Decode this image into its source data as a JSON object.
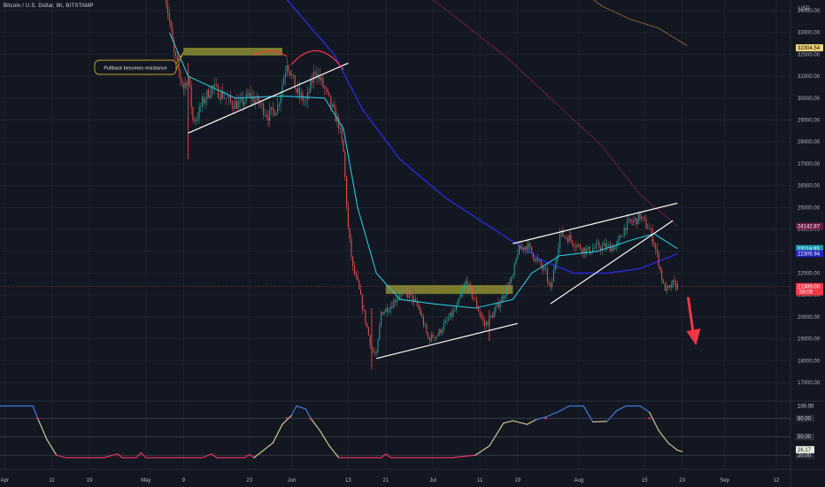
{
  "header": {
    "title": "Bitcoin / U.S. Dollar, 8h, BITSTAMP"
  },
  "colors": {
    "background": "#131722",
    "grid": "#1e222d",
    "up": "#26a69a",
    "down": "#ef5350",
    "ema_fast": "#26c6da",
    "ema_mid": "#2a2ad8",
    "ema_slow": "#8b1a5a",
    "ema_long": "#c8913a",
    "rsi_mid": "#c8c88a",
    "rsi_high": "#3f7bd9",
    "rsi_low": "#e0306b",
    "zone": "#a2a234",
    "arrow": "#f23645",
    "last_price": "#f23645"
  },
  "chart_data": {
    "type": "candlestick",
    "title": "Bitcoin / U.S. Dollar, 8h, BITSTAMP",
    "price_axis": {
      "unit": "USD",
      "ylim": [
        16800,
        35000
      ],
      "ticks": [
        17000,
        18000,
        19000,
        20000,
        21000,
        22000,
        23000,
        24000,
        25000,
        26000,
        27000,
        28000,
        29000,
        30000,
        31000,
        32000,
        33000,
        34000
      ],
      "tick_labels": [
        "17000.00",
        "18000.00",
        "19000.00",
        "20000.00",
        "21000.00",
        "22000.00",
        "23000.00",
        "24000.00",
        "25000.00",
        "26000.00",
        "27000.00",
        "28000.00",
        "29000.00",
        "30000.00",
        "31000.00",
        "32000.00",
        "33000.00",
        "34000.00"
      ]
    },
    "time_axis": {
      "range": [
        "2022-03-31",
        "2022-09-15"
      ],
      "ticks": [
        {
          "date": "2022-04-01",
          "label": "Apr"
        },
        {
          "date": "2022-04-11",
          "label": "11"
        },
        {
          "date": "2022-04-19",
          "label": "19"
        },
        {
          "date": "2022-05-01",
          "label": "May"
        },
        {
          "date": "2022-05-09",
          "label": "9"
        },
        {
          "date": "2022-05-23",
          "label": "23"
        },
        {
          "date": "2022-06-01",
          "label": "Jun"
        },
        {
          "date": "2022-06-13",
          "label": "13"
        },
        {
          "date": "2022-06-21",
          "label": "21"
        },
        {
          "date": "2022-07-01",
          "label": "Jul"
        },
        {
          "date": "2022-07-11",
          "label": "11"
        },
        {
          "date": "2022-07-19",
          "label": "19"
        },
        {
          "date": "2022-08-01",
          "label": "Aug"
        },
        {
          "date": "2022-08-15",
          "label": "15"
        },
        {
          "date": "2022-08-23",
          "label": "23"
        },
        {
          "date": "2022-09-01",
          "label": "Sep"
        },
        {
          "date": "2022-09-12",
          "label": "12"
        }
      ]
    },
    "price_path": [
      [
        "2022-05-05",
        35000
      ],
      [
        "2022-05-06",
        33500
      ],
      [
        "2022-05-07",
        32000
      ],
      [
        "2022-05-08",
        31200
      ],
      [
        "2022-05-09",
        30500
      ],
      [
        "2022-05-10",
        31000
      ],
      [
        "2022-05-11",
        29000
      ],
      [
        "2022-05-12",
        29200
      ],
      [
        "2022-05-13",
        29800
      ],
      [
        "2022-05-15",
        30500
      ],
      [
        "2022-05-17",
        30200
      ],
      [
        "2022-05-19",
        29800
      ],
      [
        "2022-05-21",
        29700
      ],
      [
        "2022-05-23",
        30100
      ],
      [
        "2022-05-25",
        29800
      ],
      [
        "2022-05-27",
        29200
      ],
      [
        "2022-05-29",
        29600
      ],
      [
        "2022-05-31",
        31700
      ],
      [
        "2022-06-02",
        30300
      ],
      [
        "2022-06-04",
        29800
      ],
      [
        "2022-06-06",
        31300
      ],
      [
        "2022-06-08",
        30400
      ],
      [
        "2022-06-10",
        29300
      ],
      [
        "2022-06-11",
        28800
      ],
      [
        "2022-06-12",
        27500
      ],
      [
        "2022-06-13",
        24000
      ],
      [
        "2022-06-14",
        22200
      ],
      [
        "2022-06-15",
        21500
      ],
      [
        "2022-06-16",
        20500
      ],
      [
        "2022-06-18",
        18500
      ],
      [
        "2022-06-19",
        18200
      ],
      [
        "2022-06-20",
        20200
      ],
      [
        "2022-06-22",
        20500
      ],
      [
        "2022-06-24",
        21100
      ],
      [
        "2022-06-26",
        21000
      ],
      [
        "2022-06-28",
        20400
      ],
      [
        "2022-06-30",
        19000
      ],
      [
        "2022-07-02",
        19200
      ],
      [
        "2022-07-04",
        19800
      ],
      [
        "2022-07-06",
        20400
      ],
      [
        "2022-07-08",
        21600
      ],
      [
        "2022-07-10",
        20700
      ],
      [
        "2022-07-12",
        19600
      ],
      [
        "2022-07-14",
        20200
      ],
      [
        "2022-07-16",
        21000
      ],
      [
        "2022-07-18",
        21800
      ],
      [
        "2022-07-19",
        23000
      ],
      [
        "2022-07-21",
        23300
      ],
      [
        "2022-07-23",
        22600
      ],
      [
        "2022-07-25",
        22000
      ],
      [
        "2022-07-26",
        21200
      ],
      [
        "2022-07-28",
        23800
      ],
      [
        "2022-07-30",
        23600
      ],
      [
        "2022-08-01",
        23200
      ],
      [
        "2022-08-03",
        23000
      ],
      [
        "2022-08-05",
        23200
      ],
      [
        "2022-08-07",
        23200
      ],
      [
        "2022-08-09",
        23200
      ],
      [
        "2022-08-11",
        24200
      ],
      [
        "2022-08-13",
        24400
      ],
      [
        "2022-08-14",
        24600
      ],
      [
        "2022-08-15",
        24300
      ],
      [
        "2022-08-16",
        24000
      ],
      [
        "2022-08-17",
        23400
      ],
      [
        "2022-08-18",
        22500
      ],
      [
        "2022-08-19",
        21400
      ],
      [
        "2022-08-20",
        21200
      ],
      [
        "2022-08-21",
        21500
      ],
      [
        "2022-08-22",
        21389
      ]
    ],
    "ema_fast": [
      [
        "2022-05-06",
        33000
      ],
      [
        "2022-05-10",
        31000
      ],
      [
        "2022-05-20",
        30000
      ],
      [
        "2022-05-30",
        30100
      ],
      [
        "2022-06-08",
        30000
      ],
      [
        "2022-06-12",
        28600
      ],
      [
        "2022-06-15",
        25000
      ],
      [
        "2022-06-19",
        22000
      ],
      [
        "2022-06-24",
        20800
      ],
      [
        "2022-07-01",
        20600
      ],
      [
        "2022-07-10",
        20400
      ],
      [
        "2022-07-18",
        20800
      ],
      [
        "2022-07-22",
        22000
      ],
      [
        "2022-07-28",
        22800
      ],
      [
        "2022-08-05",
        23000
      ],
      [
        "2022-08-12",
        23500
      ],
      [
        "2022-08-17",
        23800
      ],
      [
        "2022-08-22",
        23120
      ]
    ],
    "ema_mid": [
      [
        "2022-05-29",
        35000
      ],
      [
        "2022-06-04",
        33500
      ],
      [
        "2022-06-10",
        32000
      ],
      [
        "2022-06-16",
        29500
      ],
      [
        "2022-06-24",
        27200
      ],
      [
        "2022-07-04",
        25400
      ],
      [
        "2022-07-14",
        24000
      ],
      [
        "2022-07-24",
        22600
      ],
      [
        "2022-07-31",
        22000
      ],
      [
        "2022-08-07",
        22000
      ],
      [
        "2022-08-14",
        22200
      ],
      [
        "2022-08-22",
        22890
      ]
    ],
    "ema_slow": [
      [
        "2022-06-28",
        35000
      ],
      [
        "2022-07-07",
        33500
      ],
      [
        "2022-07-17",
        31800
      ],
      [
        "2022-07-27",
        29800
      ],
      [
        "2022-08-06",
        27800
      ],
      [
        "2022-08-14",
        25600
      ],
      [
        "2022-08-22",
        24140
      ]
    ],
    "ema_long": [
      [
        "2022-08-01",
        35000
      ],
      [
        "2022-08-06",
        34200
      ],
      [
        "2022-08-12",
        33600
      ],
      [
        "2022-08-18",
        33200
      ],
      [
        "2022-08-24",
        32400
      ]
    ],
    "price_labels": [
      {
        "label": "32304.54",
        "value": 32300,
        "color": "#c8913a",
        "bg": "#f5d57a",
        "fg": "#000000"
      },
      {
        "label": "24142.87",
        "value": 24140,
        "color": "#8b1a5a",
        "bg": "#6b1a45",
        "fg": "#ffffff"
      },
      {
        "label": "23114.93",
        "value": 23120,
        "color": "#26c6da",
        "bg": "#169ab0",
        "fg": "#ffffff"
      },
      {
        "label": "22305.94",
        "value": 22890,
        "color": "#2a2ad8",
        "bg": "#2020b8",
        "fg": "#ffffff"
      },
      {
        "label": "21389.00",
        "value": 21389,
        "color": "#f23645",
        "bg": "#f23645",
        "fg": "#ffffff",
        "sub": "58:09"
      }
    ],
    "zones": [
      {
        "from": "2022-05-09",
        "to": "2022-05-30",
        "low": 31950,
        "high": 32300
      },
      {
        "from": "2022-06-21",
        "to": "2022-07-18",
        "low": 21050,
        "high": 21450
      }
    ],
    "trendlines": [
      {
        "from": [
          "2022-05-10",
          28400
        ],
        "to": [
          "2022-06-13",
          31600
        ]
      },
      {
        "from": [
          "2022-06-19",
          18100
        ],
        "to": [
          "2022-07-19",
          19700
        ]
      },
      {
        "from": [
          "2022-07-18",
          23350
        ],
        "to": [
          "2022-08-22",
          25200
        ]
      },
      {
        "from": [
          "2022-07-26",
          20600
        ],
        "to": [
          "2022-08-21",
          24400
        ]
      }
    ],
    "arcs": [
      {
        "from": [
          "2022-05-24",
          31950
        ],
        "to": [
          "2022-05-31",
          31900
        ],
        "peak": 32400
      },
      {
        "from": [
          "2022-06-01",
          31550
        ],
        "to": [
          "2022-06-12",
          31300
        ],
        "peak": 32900
      }
    ],
    "annotation": {
      "text": "Pullback becomes resistance",
      "anchor": [
        "2022-05-09",
        32100
      ]
    },
    "arrow": {
      "from": [
        "2022-08-25",
        20900
      ],
      "to": [
        "2022-08-25",
        18700
      ]
    },
    "rsi": {
      "ylim": [
        0,
        105
      ],
      "ticks": [
        {
          "value": 100,
          "label": "100.00"
        },
        {
          "value": 80,
          "label": "80.00"
        },
        {
          "value": 50,
          "label": "50.00"
        },
        {
          "value": 20,
          "label": "20.00"
        }
      ],
      "bands": [
        80,
        50,
        20
      ],
      "last": {
        "label": "26.17",
        "value": 26.17
      },
      "path": [
        [
          "2022-03-31",
          100
        ],
        [
          "2022-04-07",
          100
        ],
        [
          "2022-04-08",
          80
        ],
        [
          "2022-04-10",
          45
        ],
        [
          "2022-04-12",
          20
        ],
        [
          "2022-04-14",
          16
        ],
        [
          "2022-04-22",
          16
        ],
        [
          "2022-04-25",
          22
        ],
        [
          "2022-04-26",
          16
        ],
        [
          "2022-04-29",
          16
        ],
        [
          "2022-04-30",
          24
        ],
        [
          "2022-05-01",
          16
        ],
        [
          "2022-05-08",
          16
        ],
        [
          "2022-05-13",
          16
        ],
        [
          "2022-05-15",
          22
        ],
        [
          "2022-05-16",
          16
        ],
        [
          "2022-05-22",
          16
        ],
        [
          "2022-05-23",
          21
        ],
        [
          "2022-05-24",
          16
        ],
        [
          "2022-05-28",
          40
        ],
        [
          "2022-05-30",
          70
        ],
        [
          "2022-06-01",
          85
        ],
        [
          "2022-06-02",
          100
        ],
        [
          "2022-06-04",
          95
        ],
        [
          "2022-06-05",
          80
        ],
        [
          "2022-06-07",
          60
        ],
        [
          "2022-06-09",
          35
        ],
        [
          "2022-06-11",
          16
        ],
        [
          "2022-06-20",
          16
        ],
        [
          "2022-06-21",
          22
        ],
        [
          "2022-06-22",
          16
        ],
        [
          "2022-07-05",
          16
        ],
        [
          "2022-07-10",
          20
        ],
        [
          "2022-07-13",
          35
        ],
        [
          "2022-07-16",
          72
        ],
        [
          "2022-07-18",
          76
        ],
        [
          "2022-07-21",
          70
        ],
        [
          "2022-07-23",
          78
        ],
        [
          "2022-07-25",
          82
        ],
        [
          "2022-07-28",
          92
        ],
        [
          "2022-07-30",
          100
        ],
        [
          "2022-08-02",
          100
        ],
        [
          "2022-08-04",
          74
        ],
        [
          "2022-08-07",
          75
        ],
        [
          "2022-08-09",
          92
        ],
        [
          "2022-08-11",
          100
        ],
        [
          "2022-08-14",
          100
        ],
        [
          "2022-08-16",
          90
        ],
        [
          "2022-08-18",
          60
        ],
        [
          "2022-08-20",
          40
        ],
        [
          "2022-08-22",
          28
        ],
        [
          "2022-08-23",
          26
        ]
      ]
    }
  }
}
